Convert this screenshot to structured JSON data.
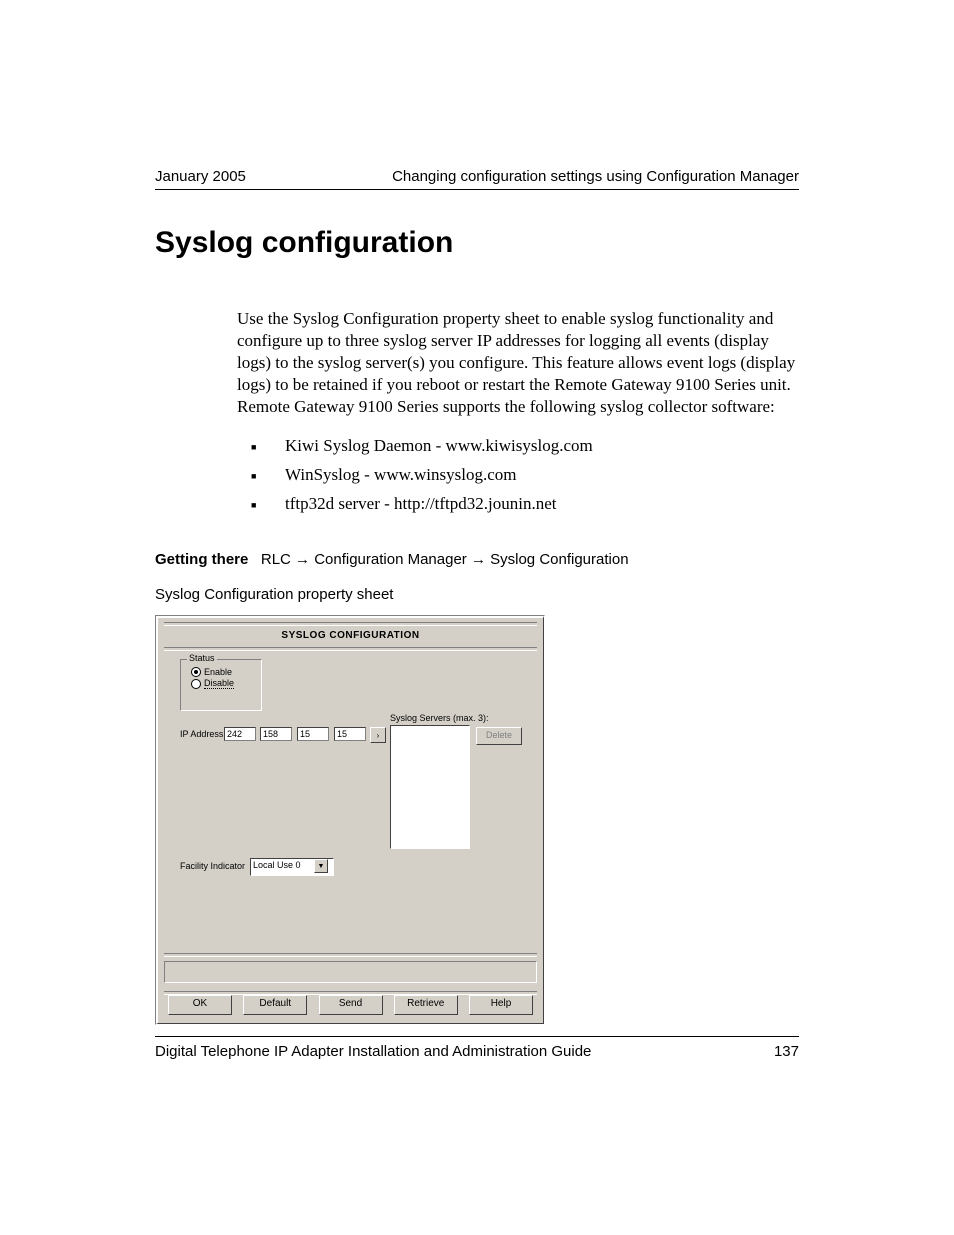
{
  "header": {
    "left": "January 2005",
    "right": "Changing configuration settings using Configuration Manager"
  },
  "section_title": "Syslog configuration",
  "paragraph": "Use the Syslog Configuration property sheet to enable syslog functionality and configure up to three syslog server IP addresses for logging all events (display logs) to the syslog server(s) you configure. This feature allows event logs (display logs) to be retained if you reboot or restart the Remote Gateway 9100 Series unit. Remote Gateway 9100 Series supports the following syslog collector software:",
  "bullets": [
    "Kiwi Syslog Daemon - www.kiwisyslog.com",
    "WinSyslog - www.winsyslog.com",
    "tftp32d server - http://tftpd32.jounin.net"
  ],
  "getting_there": {
    "label": "Getting there",
    "path": "RLC → Configuration Manager → Syslog Configuration"
  },
  "sheet_caption": "Syslog Configuration property sheet",
  "dialog": {
    "title": "SYSLOG CONFIGURATION",
    "status": {
      "legend": "Status",
      "enable": "Enable",
      "disable": "Disable",
      "selected": "enable"
    },
    "ip_label": "IP Address",
    "ip": [
      "242",
      "158",
      "15",
      "15"
    ],
    "servers_label": "Syslog Servers (max. 3):",
    "delete": "Delete",
    "facility_label": "Facility Indicator",
    "facility_value": "Local Use 0",
    "buttons": {
      "ok": "OK",
      "def": "Default",
      "send": "Send",
      "retrieve": "Retrieve",
      "help": "Help"
    }
  },
  "footer": {
    "left": "Digital Telephone IP Adapter Installation and Administration Guide",
    "right": "137"
  }
}
